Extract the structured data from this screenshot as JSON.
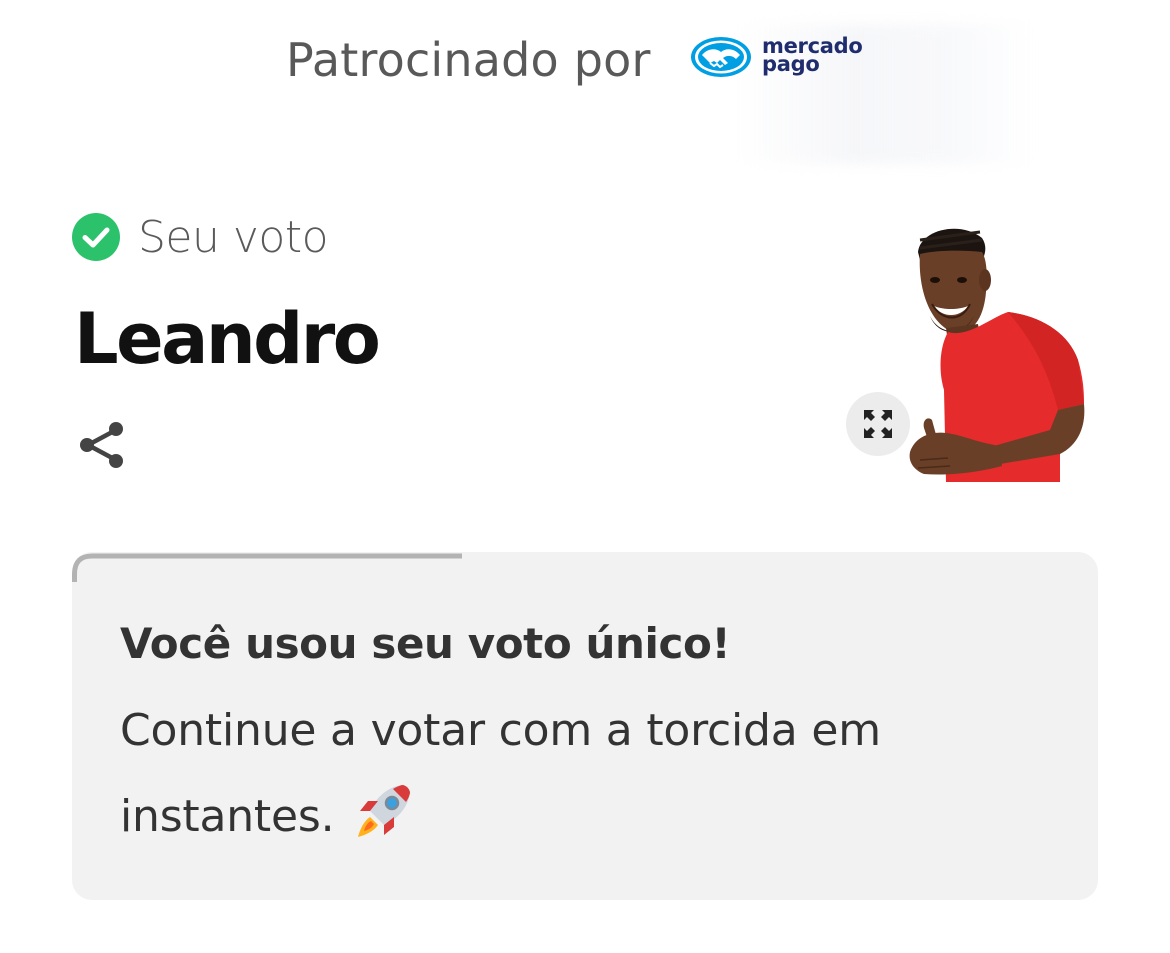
{
  "sponsor": {
    "label": "Patrocinado por",
    "brand_line1": "mercado",
    "brand_line2": "pago",
    "brand_color": "#1f2c6e",
    "logo_color": "#009ee3"
  },
  "vote": {
    "status_label": "Seu voto",
    "status_icon": "check-circle-icon",
    "status_color": "#2bc26b",
    "candidate_name": "Leandro",
    "share_icon": "share-icon",
    "expand_icon": "expand-icon",
    "photo_alt": "Leandro"
  },
  "message_card": {
    "title": "Você usou seu voto único!",
    "body": "Continue a votar com a torcida em instantes.",
    "emoji_icon": "rocket-icon",
    "background": "#f2f2f2",
    "progress_fraction": 0.38
  }
}
